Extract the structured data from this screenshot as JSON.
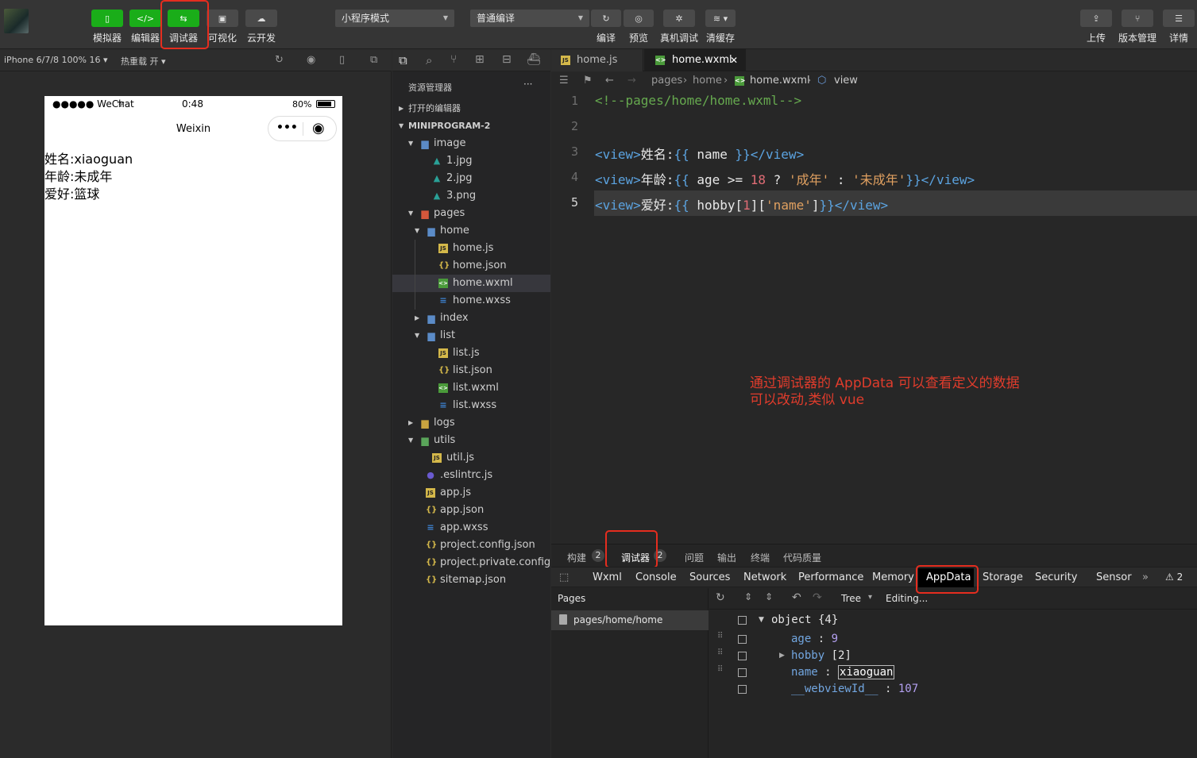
{
  "toolbar": {
    "left_buttons": [
      {
        "label": "模拟器"
      },
      {
        "label": "编辑器"
      },
      {
        "label": "调试器"
      },
      {
        "label": "可视化"
      },
      {
        "label": "云开发"
      }
    ],
    "mode_select": "小程序模式",
    "compile_select": "普通编译",
    "center_buttons": [
      {
        "label": "编译"
      },
      {
        "label": "预览"
      },
      {
        "label": "真机调试"
      },
      {
        "label": "清缓存"
      }
    ],
    "right_buttons": [
      {
        "label": "上传"
      },
      {
        "label": "版本管理"
      },
      {
        "label": "详情"
      }
    ],
    "tbtn_glyphs": {
      "sim": "▯",
      "editor": "</>",
      "debug": "⇆",
      "visual": "▣",
      "cloud": "☁",
      "compile": "↻",
      "preview": "◎",
      "realdebug": "✲",
      "cache": "≋ ▾",
      "upload": "⇪",
      "version": "⑂",
      "detail": "☰"
    }
  },
  "sim_bar": {
    "device": "iPhone 6/7/8 100% 16 ▾",
    "hot_reload": "热重载 开 ▾"
  },
  "phone": {
    "carrier": "●●●●● WeChat",
    "wifi": "ᯤ",
    "time": "0:48",
    "battery": "80%",
    "nav_title": "Weixin",
    "capsule_dots": "•••",
    "capsule_target": "◉",
    "lines": [
      "姓名:xiaoguan",
      "年龄:未成年",
      "爱好:篮球"
    ]
  },
  "explorer": {
    "title": "资源管理器",
    "more": "···",
    "open_editors": "打开的编辑器",
    "project": "MINIPROGRAM-2",
    "tree": [
      {
        "name": "image",
        "type": "folder",
        "depth": 1,
        "open": true
      },
      {
        "name": "1.jpg",
        "type": "img",
        "depth": 2
      },
      {
        "name": "2.jpg",
        "type": "img",
        "depth": 2
      },
      {
        "name": "3.png",
        "type": "img",
        "depth": 2
      },
      {
        "name": "pages",
        "type": "folder-red",
        "depth": 1,
        "open": true
      },
      {
        "name": "home",
        "type": "folder",
        "depth": 2,
        "open": true
      },
      {
        "name": "home.js",
        "type": "js",
        "depth": 3
      },
      {
        "name": "home.json",
        "type": "json",
        "depth": 3
      },
      {
        "name": "home.wxml",
        "type": "wxml",
        "depth": 3,
        "selected": true
      },
      {
        "name": "home.wxss",
        "type": "wxss",
        "depth": 3
      },
      {
        "name": "index",
        "type": "folder",
        "depth": 2,
        "open": false
      },
      {
        "name": "list",
        "type": "folder",
        "depth": 2,
        "open": true
      },
      {
        "name": "list.js",
        "type": "js",
        "depth": 3
      },
      {
        "name": "list.json",
        "type": "json",
        "depth": 3
      },
      {
        "name": "list.wxml",
        "type": "wxml",
        "depth": 3
      },
      {
        "name": "list.wxss",
        "type": "wxss",
        "depth": 3
      },
      {
        "name": "logs",
        "type": "folder-y",
        "depth": 1,
        "open": false
      },
      {
        "name": "utils",
        "type": "folder-g",
        "depth": 1,
        "open": true
      },
      {
        "name": "util.js",
        "type": "js",
        "depth": 2
      },
      {
        "name": ".eslintrc.js",
        "type": "eslint",
        "depth": 1
      },
      {
        "name": "app.js",
        "type": "js",
        "depth": 1
      },
      {
        "name": "app.json",
        "type": "json",
        "depth": 1
      },
      {
        "name": "app.wxss",
        "type": "wxss",
        "depth": 1
      },
      {
        "name": "project.config.json",
        "type": "json",
        "depth": 1
      },
      {
        "name": "project.private.config...",
        "type": "json",
        "depth": 1
      },
      {
        "name": "sitemap.json",
        "type": "json",
        "depth": 1
      }
    ]
  },
  "editor": {
    "tabs": [
      {
        "label": "home.js"
      },
      {
        "label": "home.wxml",
        "close": "✕"
      }
    ],
    "breadcrumb": {
      "pages": "pages",
      "home": "home",
      "file": "home.wxml",
      "node": "view",
      "sep": "›"
    },
    "lines": [
      {
        "no": "1",
        "parts": [
          {
            "c": "cmt",
            "t": "<!--pages/home/home.wxml-->"
          }
        ]
      },
      {
        "no": "2",
        "parts": []
      },
      {
        "no": "3",
        "parts": [
          {
            "c": "tag",
            "t": "<view>"
          },
          {
            "c": "txt",
            "t": "姓名:"
          },
          {
            "c": "tag",
            "t": "{{"
          },
          {
            "c": "txt",
            "t": " name "
          },
          {
            "c": "tag",
            "t": "}}</view>"
          }
        ]
      },
      {
        "no": "4",
        "parts": [
          {
            "c": "tag",
            "t": "<view>"
          },
          {
            "c": "txt",
            "t": "年龄:"
          },
          {
            "c": "tag",
            "t": "{{"
          },
          {
            "c": "txt",
            "t": " age >= "
          },
          {
            "c": "num",
            "t": "18"
          },
          {
            "c": "txt",
            "t": " ? "
          },
          {
            "c": "str",
            "t": "'成年'"
          },
          {
            "c": "txt",
            "t": " : "
          },
          {
            "c": "str",
            "t": "'未成年'"
          },
          {
            "c": "tag",
            "t": "}}</view>"
          }
        ]
      },
      {
        "no": "5",
        "parts": [
          {
            "c": "tag",
            "t": "<view>"
          },
          {
            "c": "txt",
            "t": "爱好:"
          },
          {
            "c": "tag",
            "t": "{{"
          },
          {
            "c": "txt",
            "t": " hobby["
          },
          {
            "c": "num",
            "t": "1"
          },
          {
            "c": "txt",
            "t": "]["
          },
          {
            "c": "str",
            "t": "'name'"
          },
          {
            "c": "txt",
            "t": "]"
          },
          {
            "c": "tag",
            "t": "}}</view>"
          }
        ]
      }
    ]
  },
  "annotation": {
    "line1": "通过调试器的 AppData 可以查看定义的数据",
    "line2": "可以改动,类似 vue"
  },
  "panel": {
    "tabs": [
      {
        "label": "构建",
        "badge": "2"
      },
      {
        "label": "调试器",
        "badge": "2"
      },
      {
        "label": "问题"
      },
      {
        "label": "输出"
      },
      {
        "label": "终端"
      },
      {
        "label": "代码质量"
      }
    ],
    "devtools_tabs": [
      "Wxml",
      "Console",
      "Sources",
      "Network",
      "Performance",
      "Memory",
      "AppData",
      "Storage",
      "Security",
      "Sensor"
    ],
    "more": "»",
    "warn": "⚠ 2",
    "pages_header": "Pages",
    "page_item": "pages/home/home",
    "view_mode": "Tree",
    "view_caret": "▾",
    "status": "Editing...",
    "data_tree": {
      "root": "object {4}",
      "rows": [
        {
          "key": "age",
          "sep": " : ",
          "value": "9"
        },
        {
          "key": "hobby",
          "sep": " ",
          "value": "[2]",
          "expandable": true
        },
        {
          "key": "name",
          "sep": " : ",
          "value": "xiaoguan",
          "editing": true
        },
        {
          "key": "__webviewId__",
          "sep": " : ",
          "value": "107"
        }
      ]
    }
  },
  "colors": {
    "accent_green": "#1aad19",
    "annotation_red": "#e03c2c",
    "highlight_box": "#e52d1f"
  }
}
